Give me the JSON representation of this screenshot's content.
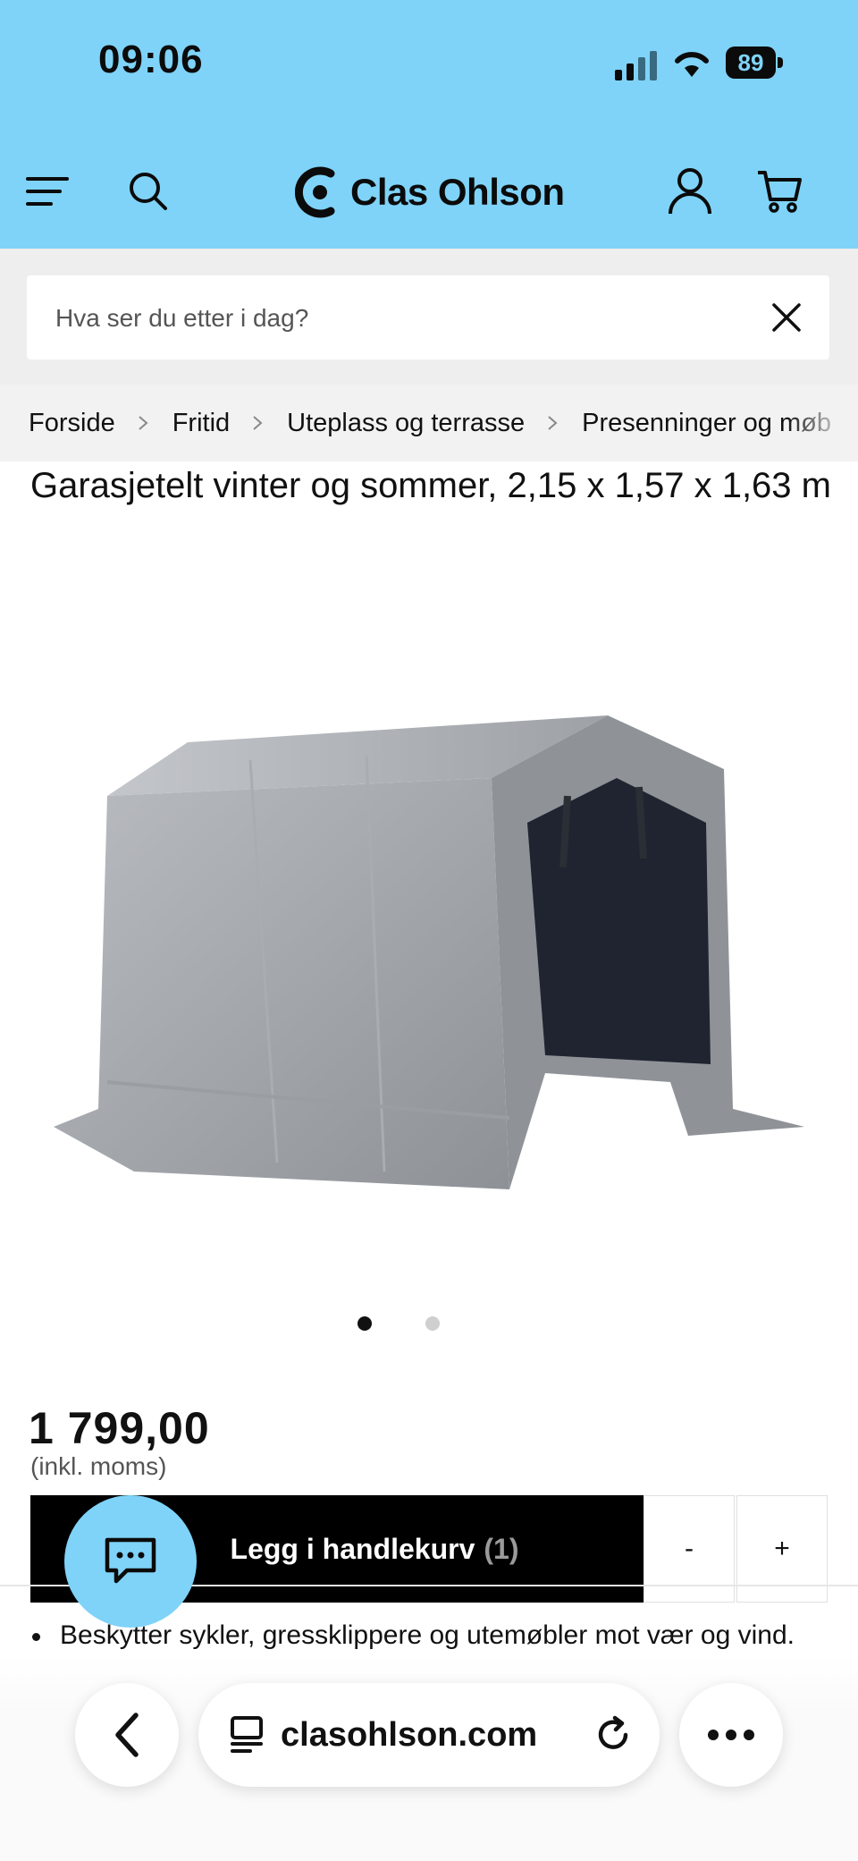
{
  "status_bar": {
    "time": "09:06",
    "battery": "89"
  },
  "header": {
    "brand": "Clas Ohlson",
    "background_color": "#7fd3f8"
  },
  "search": {
    "placeholder": "Hva ser du etter i dag?"
  },
  "breadcrumb": {
    "items": [
      "Forside",
      "Fritid",
      "Uteplass og terrasse",
      "Presenninger og møb"
    ]
  },
  "product": {
    "title": "Garasjetelt vinter og sommer, 2,15 x 1,57 x 1,63 m",
    "price": "1 799,00",
    "price_note": "(inkl. moms)",
    "image_count": 2,
    "active_image": 1
  },
  "cart": {
    "add_label": "Legg i handlekurv",
    "count": "(1)",
    "minus": "-",
    "plus": "+"
  },
  "details": {
    "first_bullet": "Beskytter sykler, gressklippere og utemøbler mot vær og vind."
  },
  "browser": {
    "url": "clasohlson.com"
  },
  "icons": {
    "menu": "hamburger-menu-icon",
    "search": "search-icon",
    "account": "user-icon",
    "cart": "shopping-cart-icon",
    "clear": "close-icon",
    "chat": "chat-icon",
    "back": "chevron-left-icon",
    "reload": "reload-icon",
    "more": "more-horizontal-icon"
  }
}
